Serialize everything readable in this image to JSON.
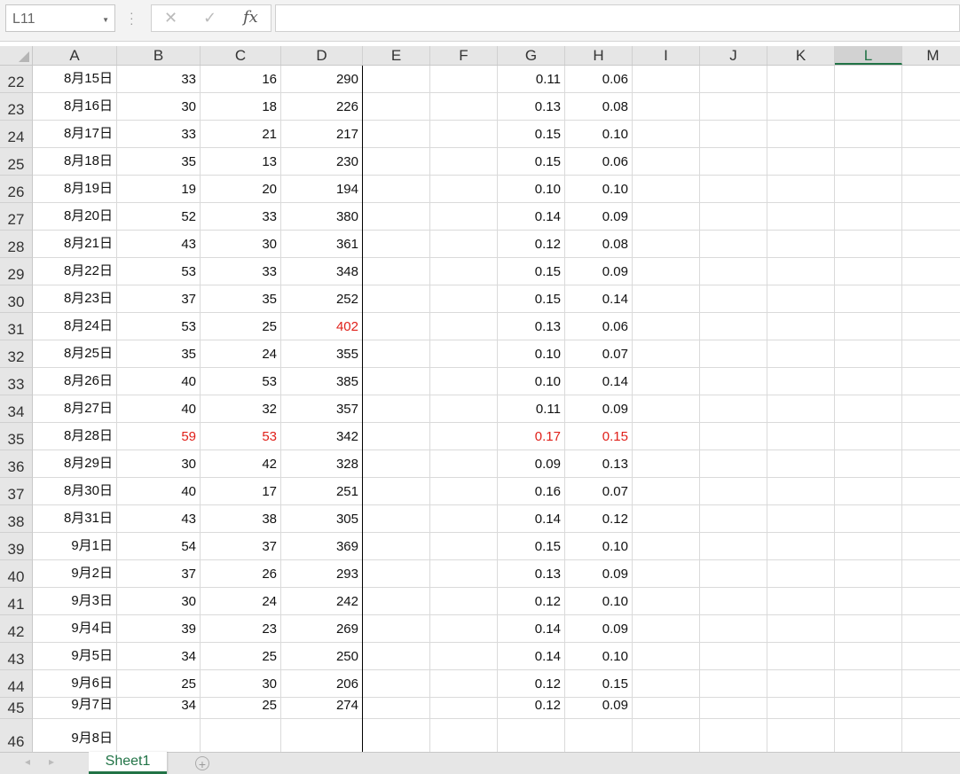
{
  "name_box": {
    "value": "L11"
  },
  "formula_bar": {
    "fx_label": "fx",
    "value": ""
  },
  "columns": [
    "A",
    "B",
    "C",
    "D",
    "E",
    "F",
    "G",
    "H",
    "I",
    "J",
    "K",
    "L",
    "M"
  ],
  "selected_column": "L",
  "rows": [
    {
      "row": "22",
      "A": "8月15日",
      "B": "33",
      "C": "16",
      "D": "290",
      "G": "0.11",
      "H": "0.06"
    },
    {
      "row": "23",
      "A": "8月16日",
      "B": "30",
      "C": "18",
      "D": "226",
      "G": "0.13",
      "H": "0.08"
    },
    {
      "row": "24",
      "A": "8月17日",
      "B": "33",
      "C": "21",
      "D": "217",
      "G": "0.15",
      "H": "0.10"
    },
    {
      "row": "25",
      "A": "8月18日",
      "B": "35",
      "C": "13",
      "D": "230",
      "G": "0.15",
      "H": "0.06"
    },
    {
      "row": "26",
      "A": "8月19日",
      "B": "19",
      "C": "20",
      "D": "194",
      "G": "0.10",
      "H": "0.10"
    },
    {
      "row": "27",
      "A": "8月20日",
      "B": "52",
      "C": "33",
      "D": "380",
      "G": "0.14",
      "H": "0.09"
    },
    {
      "row": "28",
      "A": "8月21日",
      "B": "43",
      "C": "30",
      "D": "361",
      "G": "0.12",
      "H": "0.08"
    },
    {
      "row": "29",
      "A": "8月22日",
      "B": "53",
      "C": "33",
      "D": "348",
      "G": "0.15",
      "H": "0.09"
    },
    {
      "row": "30",
      "A": "8月23日",
      "B": "37",
      "C": "35",
      "D": "252",
      "G": "0.15",
      "H": "0.14"
    },
    {
      "row": "31",
      "A": "8月24日",
      "B": "53",
      "C": "25",
      "D": "402",
      "G": "0.13",
      "H": "0.06",
      "red": [
        "D"
      ]
    },
    {
      "row": "32",
      "A": "8月25日",
      "B": "35",
      "C": "24",
      "D": "355",
      "G": "0.10",
      "H": "0.07"
    },
    {
      "row": "33",
      "A": "8月26日",
      "B": "40",
      "C": "53",
      "D": "385",
      "G": "0.10",
      "H": "0.14"
    },
    {
      "row": "34",
      "A": "8月27日",
      "B": "40",
      "C": "32",
      "D": "357",
      "G": "0.11",
      "H": "0.09"
    },
    {
      "row": "35",
      "A": "8月28日",
      "B": "59",
      "C": "53",
      "D": "342",
      "G": "0.17",
      "H": "0.15",
      "red": [
        "B",
        "C",
        "G",
        "H"
      ]
    },
    {
      "row": "36",
      "A": "8月29日",
      "B": "30",
      "C": "42",
      "D": "328",
      "G": "0.09",
      "H": "0.13"
    },
    {
      "row": "37",
      "A": "8月30日",
      "B": "40",
      "C": "17",
      "D": "251",
      "G": "0.16",
      "H": "0.07"
    },
    {
      "row": "38",
      "A": "8月31日",
      "B": "43",
      "C": "38",
      "D": "305",
      "G": "0.14",
      "H": "0.12"
    },
    {
      "row": "39",
      "A": "9月1日",
      "B": "54",
      "C": "37",
      "D": "369",
      "G": "0.15",
      "H": "0.10"
    },
    {
      "row": "40",
      "A": "9月2日",
      "B": "37",
      "C": "26",
      "D": "293",
      "G": "0.13",
      "H": "0.09"
    },
    {
      "row": "41",
      "A": "9月3日",
      "B": "30",
      "C": "24",
      "D": "242",
      "G": "0.12",
      "H": "0.10"
    },
    {
      "row": "42",
      "A": "9月4日",
      "B": "39",
      "C": "23",
      "D": "269",
      "G": "0.14",
      "H": "0.09"
    },
    {
      "row": "43",
      "A": "9月5日",
      "B": "34",
      "C": "25",
      "D": "250",
      "G": "0.14",
      "H": "0.10"
    },
    {
      "row": "44",
      "A": "9月6日",
      "B": "25",
      "C": "30",
      "D": "206",
      "G": "0.12",
      "H": "0.15"
    },
    {
      "row": "45",
      "A": "9月7日",
      "B": "34",
      "C": "25",
      "D": "274",
      "G": "0.12",
      "H": "0.09"
    },
    {
      "row": "46",
      "A": "9月8日"
    }
  ],
  "highlight_color": "#e0201a",
  "accent_color": "#217346",
  "sheet_tabs": [
    {
      "label": "Sheet1",
      "active": true
    }
  ],
  "icons": {
    "cancel": "close-icon",
    "enter": "check-icon",
    "function": "fx-icon",
    "add_sheet": "plus-circle-icon"
  }
}
